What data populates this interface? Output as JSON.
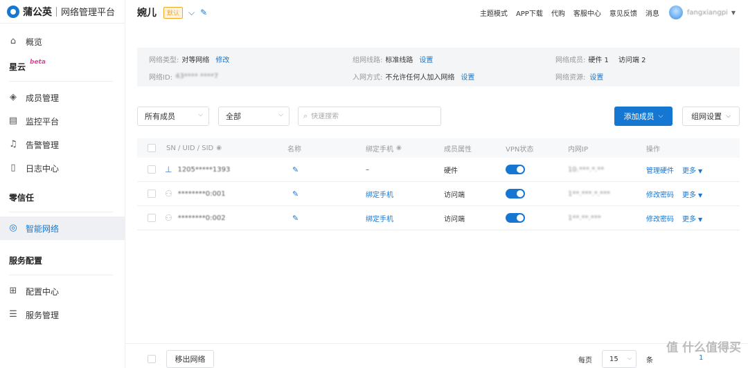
{
  "brand": {
    "name": "蒲公英",
    "subtitle": "网络管理平台"
  },
  "sidebar": {
    "overview": "概览",
    "group_xingyun": "星云",
    "beta": "beta",
    "member_mgmt": "成员管理",
    "monitor": "监控平台",
    "alert": "告警管理",
    "log": "日志中心",
    "group_zero": "零信任",
    "smart_net": "智能网络",
    "group_service": "服务配置",
    "config_center": "配置中心",
    "service_mgmt": "服务管理"
  },
  "header": {
    "network_name": "婉儿",
    "default_tag": "默认",
    "links": [
      "主题模式",
      "APP下载",
      "代购",
      "客服中心",
      "意见反馈",
      "消息"
    ],
    "username": "fangxiangpi"
  },
  "info": {
    "type_label": "网络类型:",
    "type_value": "对等网络",
    "type_action": "修改",
    "id_label": "网络ID:",
    "id_value": "43**** ****7",
    "line_label": "组网线路:",
    "line_value": "标准线路",
    "line_action": "设置",
    "join_label": "入网方式:",
    "join_value": "不允许任何人加入网络",
    "join_action": "设置",
    "members_label": "网络成员:",
    "members_hw": "硬件 1",
    "members_client": "访问端 2",
    "resources_label": "网络资源:",
    "resources_action": "设置"
  },
  "filters": {
    "member_select": "所有成员",
    "status_select": "全部",
    "search_placeholder": "快速搜索",
    "add_member": "添加成员",
    "net_settings": "组网设置"
  },
  "table": {
    "headers": {
      "sn": "SN / UID / SID",
      "name": "名称",
      "phone": "绑定手机",
      "attr": "成员属性",
      "vpn": "VPN状态",
      "ip": "内网IP",
      "ops": "操作"
    },
    "rows": [
      {
        "id": "1205*****1393",
        "phone": "–",
        "attr": "硬件",
        "ip": "10.***.*.**",
        "action": "管理硬件",
        "more": "更多",
        "vpn_on": true
      },
      {
        "id": "********0:001",
        "phone": "绑定手机",
        "attr": "访问端",
        "ip": "1**.***.*.***",
        "action": "修改密码",
        "more": "更多",
        "vpn_on": true
      },
      {
        "id": "********0:002",
        "phone": "绑定手机",
        "attr": "访问端",
        "ip": "1**.**.***",
        "action": "修改密码",
        "more": "更多",
        "vpn_on": true
      }
    ]
  },
  "footer": {
    "leave_button": "移出网络",
    "per_page_label": "每页",
    "per_page_value": "15",
    "per_page_unit": "条",
    "page": "1"
  },
  "watermark": "值 什么值得买",
  "colors": {
    "accent": "#1677d2",
    "default_tag": "#f5a623",
    "beta": "#e6459b"
  }
}
